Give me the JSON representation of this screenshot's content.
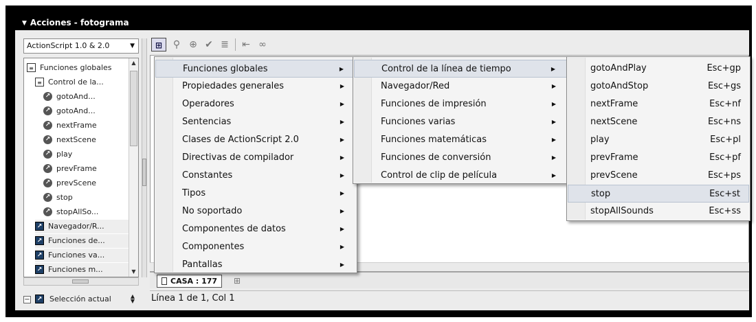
{
  "window": {
    "title": "Acciones - fotograma"
  },
  "left_panel": {
    "version_select": "ActionScript 1.0 & 2.0",
    "tree": [
      {
        "label": "Funciones globales",
        "icon": "book",
        "indent": 0,
        "type": "book"
      },
      {
        "label": "Control de la...",
        "icon": "book",
        "indent": 1,
        "type": "book"
      },
      {
        "label": "gotoAnd...",
        "icon": "function",
        "indent": 2,
        "type": "fn"
      },
      {
        "label": "gotoAnd...",
        "icon": "function",
        "indent": 2,
        "type": "fn"
      },
      {
        "label": "nextFrame",
        "icon": "function",
        "indent": 2,
        "type": "fn"
      },
      {
        "label": "nextScene",
        "icon": "function",
        "indent": 2,
        "type": "fn"
      },
      {
        "label": "play",
        "icon": "function",
        "indent": 2,
        "type": "fn"
      },
      {
        "label": "prevFrame",
        "icon": "function",
        "indent": 2,
        "type": "fn"
      },
      {
        "label": "prevScene",
        "icon": "function",
        "indent": 2,
        "type": "fn"
      },
      {
        "label": "stop",
        "icon": "function",
        "indent": 2,
        "type": "fn"
      },
      {
        "label": "stopAllSo...",
        "icon": "function",
        "indent": 2,
        "type": "fn"
      },
      {
        "label": "Navegador/R...",
        "icon": "category",
        "indent": 1,
        "type": "cat"
      },
      {
        "label": "Funciones de...",
        "icon": "category",
        "indent": 1,
        "type": "cat"
      },
      {
        "label": "Funciones va...",
        "icon": "category",
        "indent": 1,
        "type": "cat"
      },
      {
        "label": "Funciones m...",
        "icon": "category",
        "indent": 1,
        "type": "cat"
      }
    ],
    "selection_label": "Selección actual"
  },
  "menu_level1": [
    {
      "label": "Funciones globales",
      "highlighted": true
    },
    {
      "label": "Propiedades generales"
    },
    {
      "label": "Operadores"
    },
    {
      "label": "Sentencias"
    },
    {
      "label": "Clases de ActionScript 2.0"
    },
    {
      "label": "Directivas de compilador"
    },
    {
      "label": "Constantes"
    },
    {
      "label": "Tipos"
    },
    {
      "label": "No soportado"
    },
    {
      "label": "Componentes de datos"
    },
    {
      "label": "Componentes"
    },
    {
      "label": "Pantallas"
    }
  ],
  "menu_level2": [
    {
      "label": "Control de la línea de tiempo",
      "highlighted": true
    },
    {
      "label": "Navegador/Red"
    },
    {
      "label": "Funciones de impresión"
    },
    {
      "label": "Funciones varias"
    },
    {
      "label": "Funciones matemáticas"
    },
    {
      "label": "Funciones de conversión"
    },
    {
      "label": "Control de clip de película"
    }
  ],
  "menu_level3": [
    {
      "label": "gotoAndPlay",
      "shortcut": "Esc+gp"
    },
    {
      "label": "gotoAndStop",
      "shortcut": "Esc+gs"
    },
    {
      "label": "nextFrame",
      "shortcut": "Esc+nf"
    },
    {
      "label": "nextScene",
      "shortcut": "Esc+ns"
    },
    {
      "label": "play",
      "shortcut": "Esc+pl"
    },
    {
      "label": "prevFrame",
      "shortcut": "Esc+pf"
    },
    {
      "label": "prevScene",
      "shortcut": "Esc+ps"
    },
    {
      "label": "stop",
      "shortcut": "Esc+st",
      "highlighted": true
    },
    {
      "label": "stopAllSounds",
      "shortcut": "Esc+ss"
    }
  ],
  "doc_tab": {
    "label": "CASA : 177"
  },
  "status": {
    "position": "Línea 1 de 1, Col 1"
  },
  "colors": {
    "highlight": "#dfe3ea",
    "panel": "#ececec",
    "frame": "#000000"
  }
}
